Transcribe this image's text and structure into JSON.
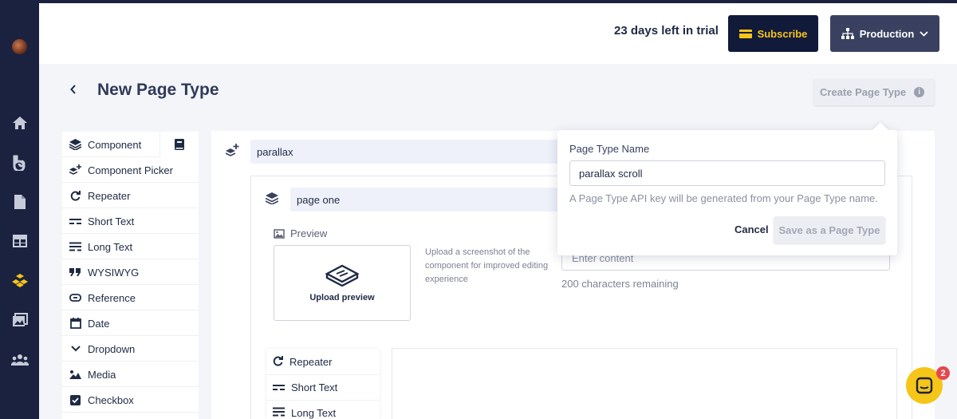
{
  "topbar": {
    "trial_text": "23 days left in trial",
    "subscribe_label": "Subscribe",
    "environment_label": "Production"
  },
  "page": {
    "title": "New Page Type",
    "create_button_label": "Create Page Type"
  },
  "components": {
    "items": [
      {
        "label": "Component",
        "icon": "stack-icon"
      },
      {
        "label": "Component Picker",
        "icon": "stack-plus-icon"
      },
      {
        "label": "Repeater",
        "icon": "repeat-icon"
      },
      {
        "label": "Short Text",
        "icon": "short-text-icon"
      },
      {
        "label": "Long Text",
        "icon": "long-text-icon"
      },
      {
        "label": "WYSIWYG",
        "icon": "quote-icon"
      },
      {
        "label": "Reference",
        "icon": "link-icon"
      },
      {
        "label": "Date",
        "icon": "calendar-icon"
      },
      {
        "label": "Dropdown",
        "icon": "chevron-down-icon"
      },
      {
        "label": "Media",
        "icon": "media-icon"
      },
      {
        "label": "Checkbox",
        "icon": "checkbox-icon"
      }
    ]
  },
  "editor": {
    "name_value": "parallax",
    "component_name_value": "page one",
    "preview_label": "Preview",
    "upload_label": "Upload preview",
    "upload_help": "Upload a screenshot of the component for improved editing experience",
    "content_placeholder": "Enter content",
    "chars_remaining": "200 characters remaining",
    "sub_items": [
      {
        "label": "Repeater"
      },
      {
        "label": "Short Text"
      },
      {
        "label": "Long Text"
      }
    ]
  },
  "popover": {
    "label": "Page Type Name",
    "input_value": "parallax scroll",
    "hint": "A Page Type API key will be generated from your Page Type name.",
    "cancel_label": "Cancel",
    "save_label": "Save as a Page Type"
  },
  "chat": {
    "badge_count": "2"
  },
  "colors": {
    "sidebar": "#1b2240",
    "accent_yellow": "#f5c518",
    "subscribe_bg": "#121a3a",
    "production_bg": "#3a4160"
  }
}
